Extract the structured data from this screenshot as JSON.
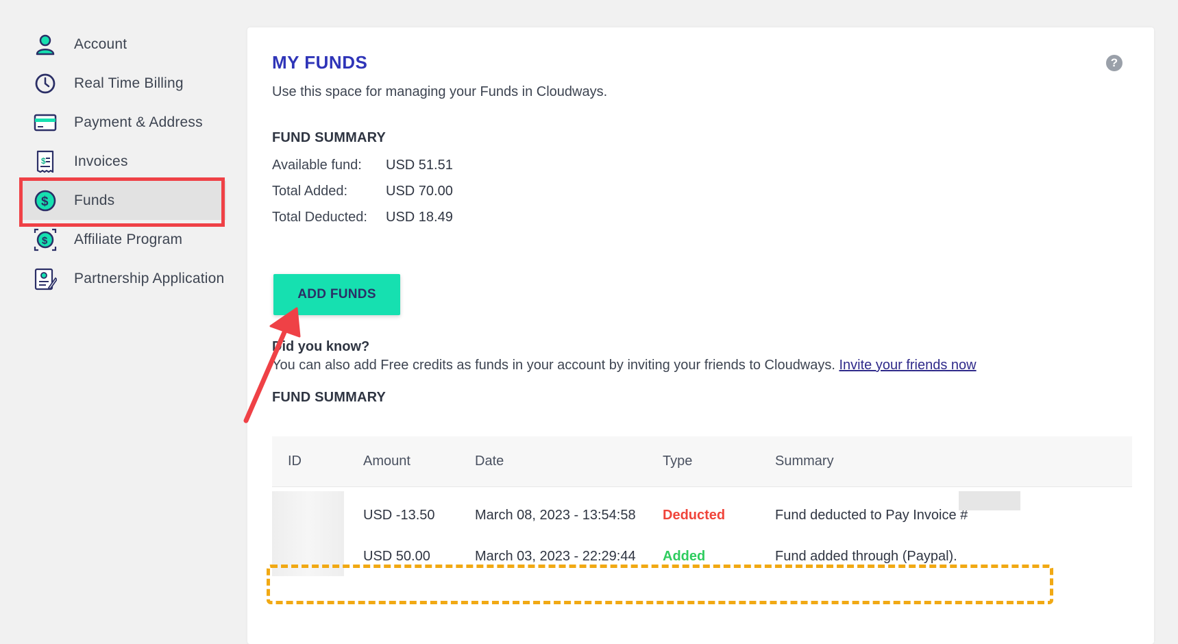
{
  "sidebar": {
    "items": [
      {
        "label": "Account",
        "icon": "account-icon"
      },
      {
        "label": "Real Time Billing",
        "icon": "clock-icon"
      },
      {
        "label": "Payment & Address",
        "icon": "credit-card-icon"
      },
      {
        "label": "Invoices",
        "icon": "invoice-icon"
      },
      {
        "label": "Funds",
        "icon": "dollar-coin-icon",
        "active": true
      },
      {
        "label": "Affiliate Program",
        "icon": "affiliate-icon"
      },
      {
        "label": "Partnership Application",
        "icon": "partnership-icon"
      }
    ]
  },
  "main": {
    "title": "MY FUNDS",
    "subtitle": "Use this space for managing your Funds in Cloudways.",
    "help_icon": "?",
    "fund_summary": {
      "heading": "FUND SUMMARY",
      "rows": [
        {
          "label": "Available fund:",
          "value": "USD 51.51"
        },
        {
          "label": "Total Added:",
          "value": "USD 70.00"
        },
        {
          "label": "Total Deducted:",
          "value": "USD 18.49"
        }
      ]
    },
    "add_funds_label": "ADD FUNDS",
    "did_you_know": {
      "heading": "Did you know?",
      "text": "You can also add Free credits as funds in your account by inviting your friends to Cloudways. ",
      "link": "Invite your friends now"
    },
    "history": {
      "heading": "FUND SUMMARY",
      "columns": [
        "ID",
        "Amount",
        "Date",
        "Type",
        "Summary"
      ],
      "rows": [
        {
          "id": "",
          "amount": "USD -13.50",
          "date": "March 08, 2023 - 13:54:58",
          "type": "Deducted",
          "summary": "Fund deducted to Pay Invoice #"
        },
        {
          "id": "",
          "amount": "USD 50.00",
          "date": "March 03, 2023 - 22:29:44",
          "type": "Added",
          "summary": "Fund added through (Paypal)."
        }
      ]
    }
  },
  "colors": {
    "accent_title": "#2f35b8",
    "button": "#16e0b0",
    "deducted": "#f0443a",
    "added": "#2ecc5e",
    "highlight_box": "#ef4146",
    "dashed_box": "#f1a914"
  }
}
